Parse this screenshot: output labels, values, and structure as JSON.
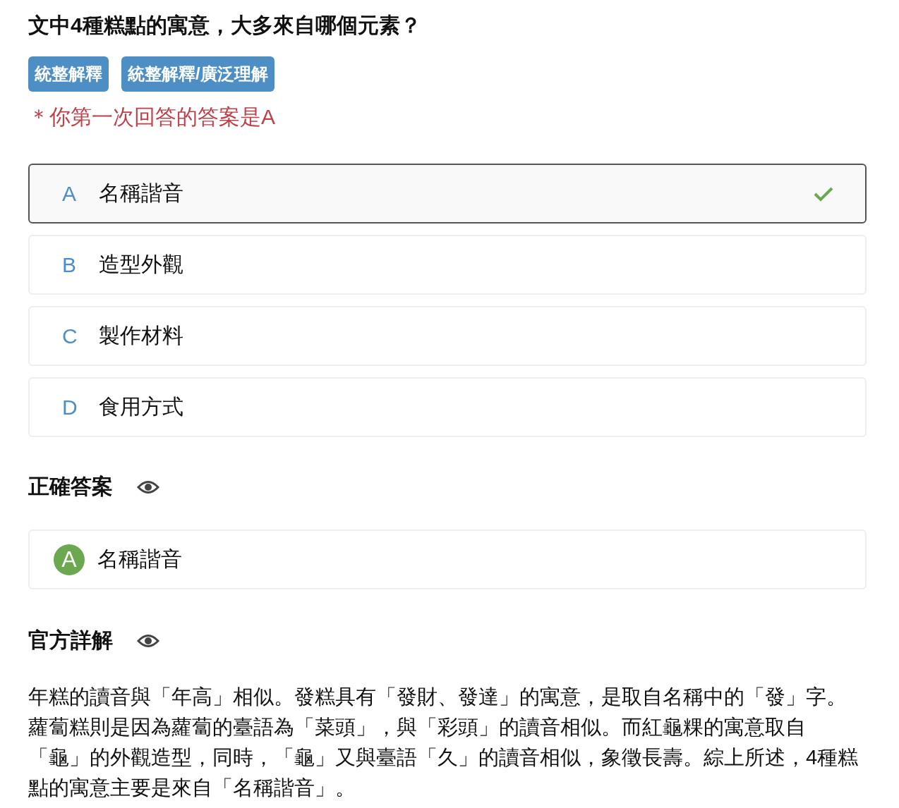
{
  "question": {
    "title": "文中4種糕點的寓意，大多來自哪個元素？",
    "tags": [
      "統整解釋",
      "統整解釋/廣泛理解"
    ],
    "first_answer_note": "＊你第一次回答的答案是A"
  },
  "options": [
    {
      "letter": "A",
      "text": "名稱諧音",
      "selected": true,
      "correct": true
    },
    {
      "letter": "B",
      "text": "造型外觀",
      "selected": false,
      "correct": false
    },
    {
      "letter": "C",
      "text": "製作材料",
      "selected": false,
      "correct": false
    },
    {
      "letter": "D",
      "text": "食用方式",
      "selected": false,
      "correct": false
    }
  ],
  "correct_answer": {
    "heading": "正確答案",
    "letter": "A",
    "text": "名稱諧音"
  },
  "explanation": {
    "heading": "官方詳解",
    "text": "年糕的讀音與「年高」相似。發糕具有「發財、發達」的寓意，是取自名稱中的「發」字。蘿蔔糕則是因為蘿蔔的臺語為「菜頭」，與「彩頭」的讀音相似。而紅龜粿的寓意取自「龜」的外觀造型，同時，「龜」又與臺語「久」的讀音相似，象徵長壽。綜上所述，4種糕點的寓意主要是來自「名稱諧音」。"
  }
}
